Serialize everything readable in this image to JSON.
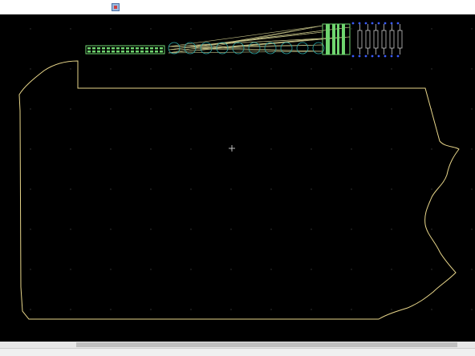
{
  "toolbar": {
    "icon": "app-icon"
  },
  "canvas": {
    "background": "#000000",
    "grid_color": "#3a3a3a",
    "outline_color": "#e8d68a",
    "pad_color": "#6fd56f",
    "trace_color": "#f4f1a8",
    "circle_color": "#2aa6a6",
    "label_color": "#3b5cff"
  },
  "scrollbar": {
    "horizontal": true
  },
  "statusbar": {
    "text": ""
  }
}
